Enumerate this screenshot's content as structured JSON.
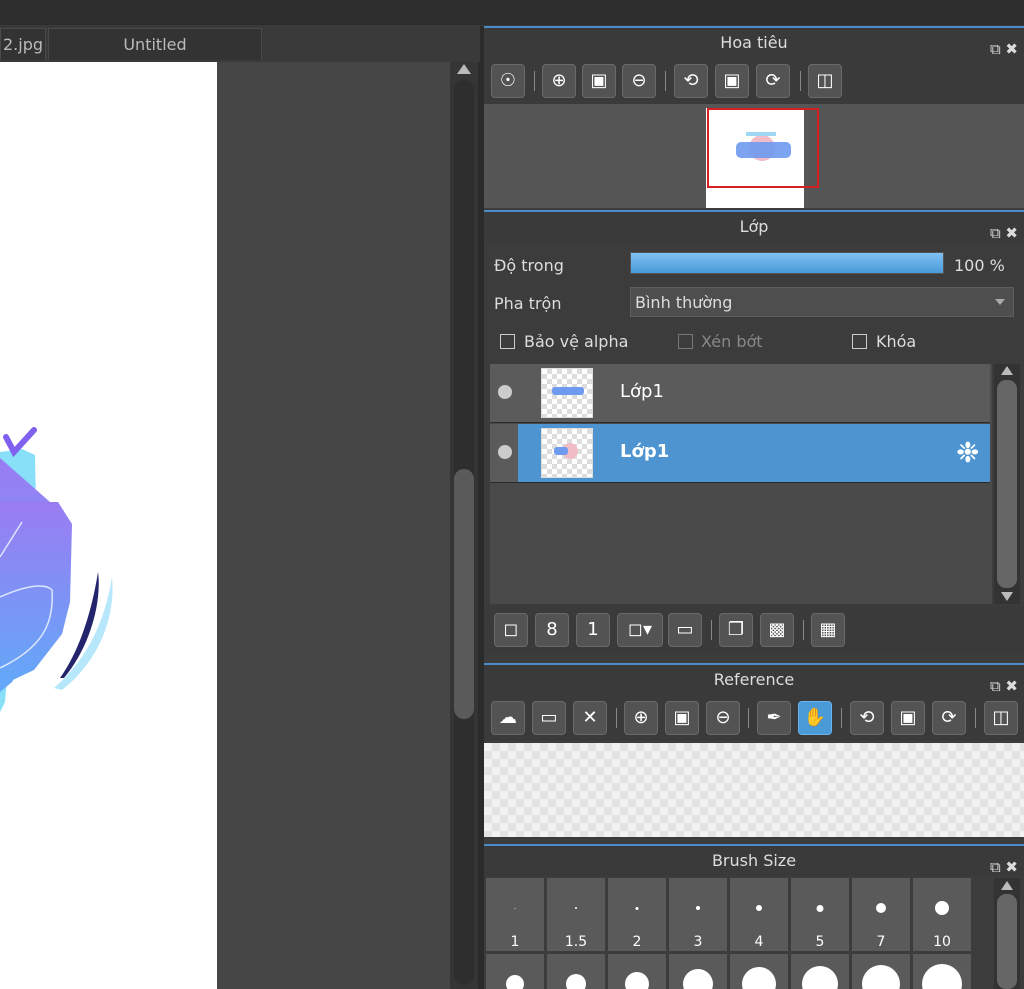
{
  "tabs": [
    {
      "label": "2.jpg"
    },
    {
      "label": "Untitled"
    }
  ],
  "navigator": {
    "title": "Hoa tiêu",
    "controls": "⧉ ✖"
  },
  "layers": {
    "title": "Lớp",
    "controls": "⧉ ✖",
    "opacity_label": "Độ trong",
    "opacity_value": "100 %",
    "opacity_percent": 100,
    "blend_label": "Pha trộn",
    "blend_value": "Bình thường",
    "protect_alpha": "Bảo vệ alpha",
    "clipping": "Xén bớt",
    "lock": "Khóa",
    "items": [
      {
        "name": "Lớp1"
      },
      {
        "name": "Lớp1"
      }
    ]
  },
  "reference": {
    "title": "Reference",
    "controls": "⧉ ✖"
  },
  "brush_size": {
    "title": "Brush Size",
    "controls": "⧉ ✖",
    "sizes": [
      "1",
      "1.5",
      "2",
      "3",
      "4",
      "5",
      "7",
      "10"
    ]
  },
  "colors": {
    "accent": "#4a9ad8",
    "selection_red": "#d42020",
    "panel_bg": "#3c3c3c"
  }
}
